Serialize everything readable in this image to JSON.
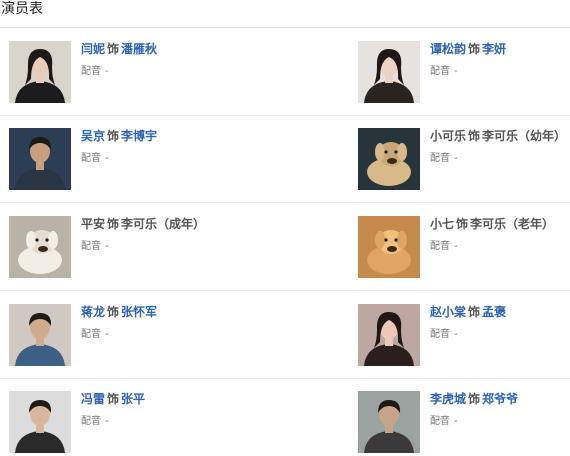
{
  "page": {
    "title": "演员表",
    "role_connector": "饰",
    "voice_label": "配音",
    "voice_empty": "-"
  },
  "cast": [
    {
      "actor": "闫妮",
      "role": "潘雁秋",
      "actor_link": true,
      "role_link": true,
      "voice": "-"
    },
    {
      "actor": "谭松韵",
      "role": "李妍",
      "actor_link": true,
      "role_link": true,
      "voice": "-"
    },
    {
      "actor": "吴京",
      "role": "李博宇",
      "actor_link": true,
      "role_link": true,
      "voice": "-"
    },
    {
      "actor": "小可乐",
      "role": "李可乐（幼年）",
      "actor_link": false,
      "role_link": false,
      "voice": "-"
    },
    {
      "actor": "平安",
      "role": "李可乐（成年）",
      "actor_link": false,
      "role_link": false,
      "voice": "-"
    },
    {
      "actor": "小七",
      "role": "李可乐（老年）",
      "actor_link": false,
      "role_link": false,
      "voice": "-"
    },
    {
      "actor": "蒋龙",
      "role": "张怀军",
      "actor_link": true,
      "role_link": true,
      "voice": "-"
    },
    {
      "actor": "赵小棠",
      "role": "孟褒",
      "actor_link": true,
      "role_link": true,
      "voice": "-"
    },
    {
      "actor": "冯雷",
      "role": "张平",
      "actor_link": true,
      "role_link": true,
      "voice": "-"
    },
    {
      "actor": "李虎城",
      "role": "郑爷爷",
      "actor_link": true,
      "role_link": true,
      "voice": "-"
    }
  ],
  "photos": [
    {
      "icon": "actress-portrait-photo",
      "bg": "#d9d4cc",
      "fg": "#1c1c1c",
      "skin": "#e9cdb9"
    },
    {
      "icon": "actress-portrait-photo",
      "bg": "#e6e2df",
      "fg": "#2a2320",
      "skin": "#ecd2c2"
    },
    {
      "icon": "actor-portrait-photo",
      "bg": "#2c3e55",
      "fg": "#2b3442",
      "skin": "#c8a07e"
    },
    {
      "icon": "puppy-photo",
      "bg": "#27353b",
      "fg": "#d8b98a",
      "skin": "#c9a676"
    },
    {
      "icon": "dog-photo",
      "bg": "#b9b2a6",
      "fg": "#f2eee6",
      "skin": "#e6dccb"
    },
    {
      "icon": "golden-dog-photo",
      "bg": "#c68a4c",
      "fg": "#e0a565",
      "skin": "#f1c27c"
    },
    {
      "icon": "actor-portrait-photo",
      "bg": "#cfc9c2",
      "fg": "#3d5f84",
      "skin": "#d1ab8d"
    },
    {
      "icon": "actress-portrait-photo",
      "bg": "#bda7a0",
      "fg": "#2a1f1d",
      "skin": "#ecc9b6"
    },
    {
      "icon": "actor-portrait-photo",
      "bg": "#dcdcdc",
      "fg": "#2a2a2a",
      "skin": "#d8b79c"
    },
    {
      "icon": "actor-portrait-photo",
      "bg": "#9aa39f",
      "fg": "#3a3a3a",
      "skin": "#c7a489"
    }
  ],
  "colors": {
    "link": "#2d64b3",
    "text": "#555555",
    "muted": "#777777"
  }
}
